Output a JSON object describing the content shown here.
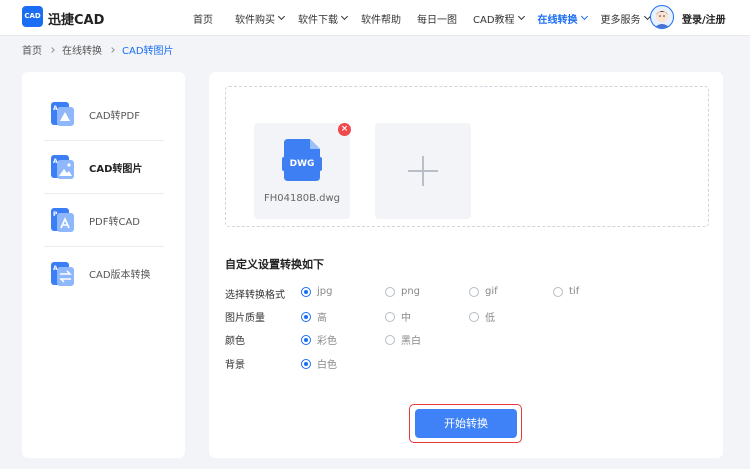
{
  "header": {
    "logo_badge": "CAD",
    "logo_text": "迅捷CAD",
    "nav": [
      {
        "label": "首页",
        "dropdown": false,
        "active": false
      },
      {
        "label": "软件购买",
        "dropdown": true,
        "active": false
      },
      {
        "label": "软件下载",
        "dropdown": true,
        "active": false
      },
      {
        "label": "软件帮助",
        "dropdown": false,
        "active": false
      },
      {
        "label": "每日一图",
        "dropdown": false,
        "active": false
      },
      {
        "label": "CAD教程",
        "dropdown": true,
        "active": false
      },
      {
        "label": "在线转换",
        "dropdown": true,
        "active": true
      },
      {
        "label": "更多服务",
        "dropdown": true,
        "active": false
      }
    ],
    "login_label": "登录/注册"
  },
  "breadcrumb": [
    "首页",
    "在线转换",
    "CAD转图片"
  ],
  "sidebar": {
    "items": [
      {
        "label": "CAD转PDF",
        "active": false,
        "icon": "cad-to-pdf-icon"
      },
      {
        "label": "CAD转图片",
        "active": true,
        "icon": "cad-to-image-icon"
      },
      {
        "label": "PDF转CAD",
        "active": false,
        "icon": "pdf-to-cad-icon"
      },
      {
        "label": "CAD版本转换",
        "active": false,
        "icon": "cad-version-convert-icon"
      }
    ]
  },
  "upload": {
    "file_badge": "DWG",
    "file_name": "FH04180B.dwg",
    "remove_symbol": "×"
  },
  "settings": {
    "title": "自定义设置转换如下",
    "rows": [
      {
        "label": "选择转换格式",
        "options": [
          "jpg",
          "png",
          "gif",
          "tif"
        ],
        "selected": "jpg"
      },
      {
        "label": "图片质量",
        "options": [
          "高",
          "中",
          "低"
        ],
        "selected": "高"
      },
      {
        "label": "颜色",
        "options": [
          "彩色",
          "黑白"
        ],
        "selected": "彩色"
      },
      {
        "label": "背景",
        "options": [
          "白色"
        ],
        "selected": "白色"
      }
    ]
  },
  "start_button": "开始转换",
  "colors": {
    "accent": "#1b6ef3",
    "button": "#3f82f7",
    "highlight_outline": "#e8393b",
    "remove_badge": "#f0484b"
  }
}
